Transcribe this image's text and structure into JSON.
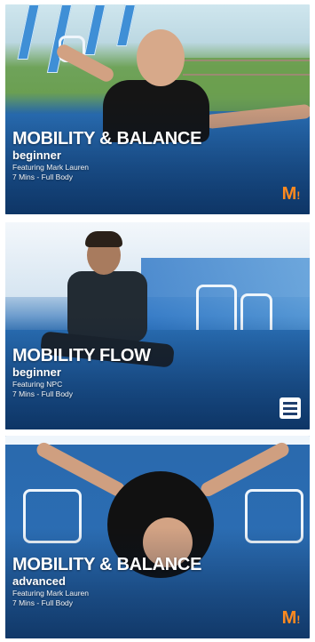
{
  "workouts": [
    {
      "title": "MOBILITY & BALANCE",
      "level": "beginner",
      "featuring": "Featuring Mark Lauren",
      "details": "7 Mins - Full Body",
      "badge_icon": "mark-lauren-logo-icon",
      "accent": "#ff8a1f"
    },
    {
      "title": "MOBILITY FLOW",
      "level": "beginner",
      "featuring": "Featuring NPC",
      "details": "7 Mins - Full Body",
      "badge_icon": "flag-badge-icon",
      "accent": "#ffffff"
    },
    {
      "title": "MOBILITY & BALANCE",
      "level": "advanced",
      "featuring": "Featuring Mark Lauren",
      "details": "7 Mins - Full Body",
      "badge_icon": "mark-lauren-logo-icon",
      "accent": "#ff8a1f"
    }
  ]
}
